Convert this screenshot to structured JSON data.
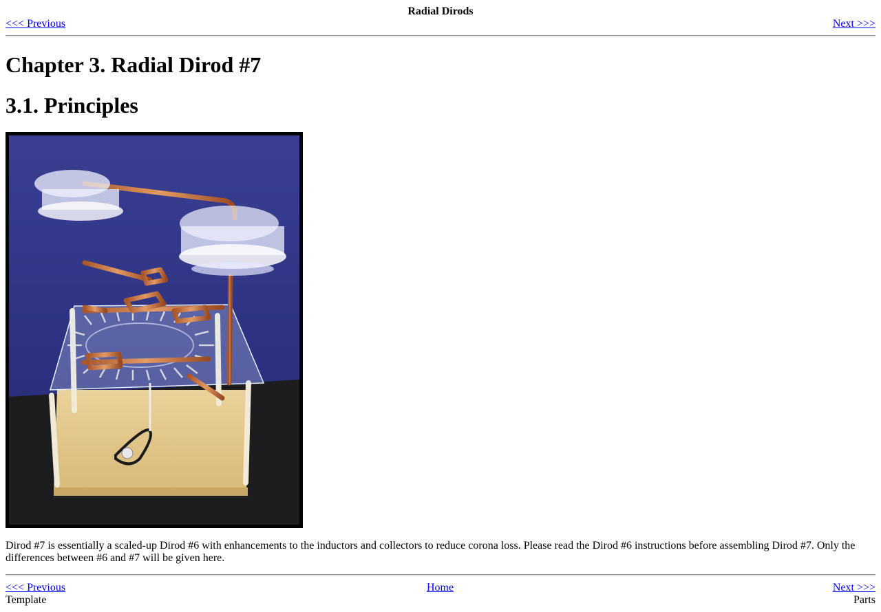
{
  "header": {
    "title": "Radial Dirods",
    "prev_label": "<<< Previous",
    "next_label": "Next >>>"
  },
  "main": {
    "chapter_title": "Chapter 3. Radial Dirod #7",
    "section_title": "3.1. Principles",
    "paragraph": "Dirod #7 is essentially a scaled-up Dirod #6 with enhancements to the inductors and collectors to reduce corona loss. Please read the Dirod #6 instructions before assembling Dirod #7. Only the differences between #6 and #7 will be given here."
  },
  "footer": {
    "prev_label": "<<< Previous",
    "home_label": "Home",
    "next_label": "Next >>>",
    "prev_title": "Template",
    "next_title": "Parts"
  }
}
